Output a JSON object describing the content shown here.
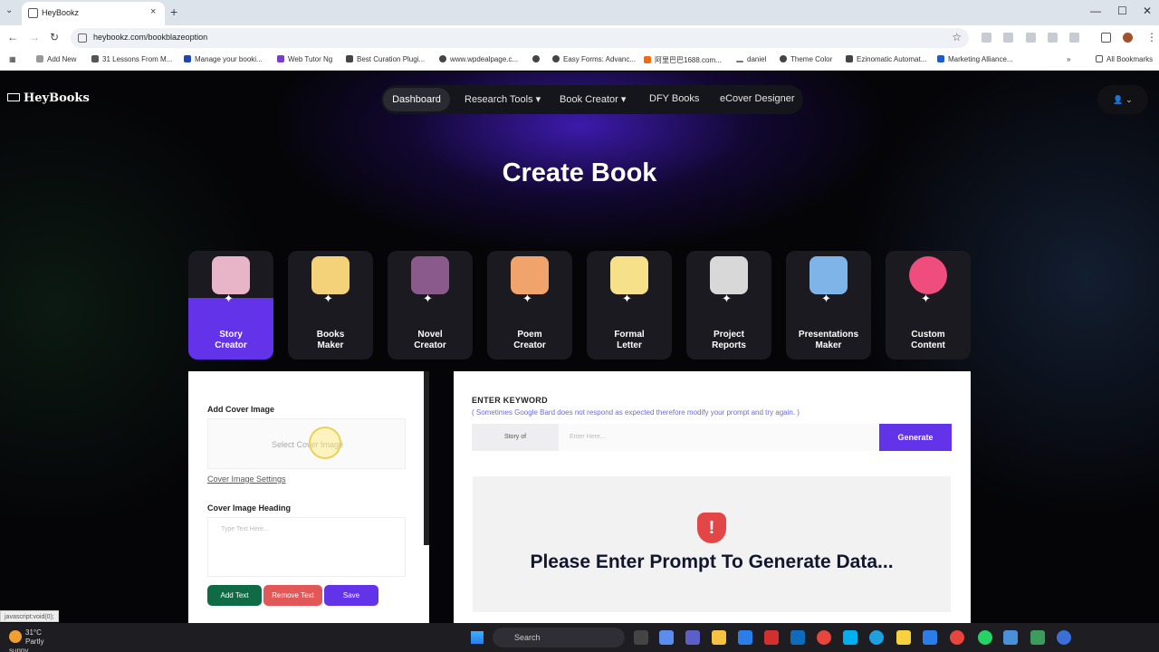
{
  "browser": {
    "tab_title": "HeyBookz",
    "tab_close": "×",
    "new_tab": "+",
    "url": "heybookz.com/bookblazeoption",
    "back": "←",
    "forward": "→",
    "reload": "↻",
    "star": "☆",
    "minimize": "—",
    "maximize": "☐",
    "close": "✕",
    "bookmarks": [
      {
        "label": "Add New",
        "color": "#999"
      },
      {
        "label": "31 Lessons From M...",
        "color": "#555"
      },
      {
        "label": "Manage your booki...",
        "color": "#1a47b8"
      },
      {
        "label": "Web Tutor Ng",
        "color": "#7a3bd1"
      },
      {
        "label": "Best Curation Plugi...",
        "color": "#444"
      },
      {
        "label": "www.wpdealpage.c...",
        "color": "#444"
      },
      {
        "label": "",
        "color": "#444"
      },
      {
        "label": "Easy Forms: Advanc...",
        "color": "#444"
      },
      {
        "label": "阿里巴巴1688.com...",
        "color": "#f46b0f"
      },
      {
        "label": "daniel",
        "color": "#777"
      },
      {
        "label": "Theme Color",
        "color": "#444"
      },
      {
        "label": "Ezinomatic Automat...",
        "color": "#444"
      },
      {
        "label": "Marketing Alliance...",
        "color": "#1a5bd8"
      }
    ],
    "all_bookmarks": "All Bookmarks",
    "status_text": "javascript:void(0);"
  },
  "site": {
    "logo": "HeyBooks",
    "nav": {
      "dashboard": "Dashboard",
      "research_tools": "Research Tools ▾",
      "book_creator": "Book Creator ▾",
      "dfy_books": "DFY Books",
      "ecover_designer": "eCover Designer"
    },
    "user_menu": "👤 ⌄",
    "page_title": "Create Book",
    "tools": [
      {
        "label": "Story\nCreator",
        "icon": "story-book-icon",
        "color": "#e8b4c8"
      },
      {
        "label": "Books\nMaker",
        "icon": "book-pencil-icon",
        "color": "#f3d27a"
      },
      {
        "label": "Novel\nCreator",
        "icon": "novel-moon-book-icon",
        "color": "#8b5a8c"
      },
      {
        "label": "Poem\nCreator",
        "icon": "poem-scroll-icon",
        "color": "#f0a36b"
      },
      {
        "label": "Formal\nLetter",
        "icon": "letter-document-icon",
        "color": "#f7e08a"
      },
      {
        "label": "Project\nReports",
        "icon": "project-report-icon",
        "color": "#d8d8d8"
      },
      {
        "label": "Presentations\nMaker",
        "icon": "presenter-icon",
        "color": "#7fb4e8"
      },
      {
        "label": "Custom\nContent",
        "icon": "custom-pen-icon",
        "color": "#ee4d7d"
      }
    ],
    "left_panel": {
      "add_cover_label": "Add Cover Image",
      "select_cover": "Select Cover Image",
      "cover_settings": "Cover Image Settings",
      "heading_label": "Cover Image Heading",
      "heading_placeholder": "Type Text Here...",
      "add_text": "Add Text",
      "remove_text": "Remove Text",
      "save": "Save"
    },
    "right_panel": {
      "title": "ENTER KEYWORD",
      "note": "( Sometimes Google Bard does not respond as expected therefore modify your prompt and try again. )",
      "prefix": "Story of",
      "input_placeholder": "Enter Here...",
      "generate": "Generate",
      "alert_symbol": "!",
      "empty_message": "Please Enter Prompt To Generate Data..."
    }
  },
  "taskbar": {
    "temperature": "31°C",
    "weather": "Partly sunny",
    "search": "Search"
  }
}
